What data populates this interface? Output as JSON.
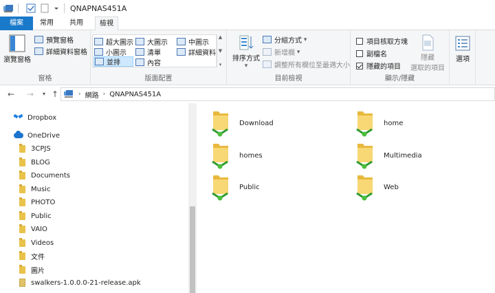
{
  "window": {
    "title": "QNAPNAS451A"
  },
  "tabs": {
    "file": "檔案",
    "home": "常用",
    "share": "共用",
    "view": "檢視"
  },
  "ribbon": {
    "panes": {
      "label": "窗格",
      "nav_pane": "瀏覽窗格",
      "preview": "預覽窗格",
      "details": "詳細資料窗格"
    },
    "layout": {
      "label": "版面配置",
      "extra_large": "超大圖示",
      "large": "大圖示",
      "medium": "中圖示",
      "small": "小圖示",
      "list": "清單",
      "details": "詳細資料",
      "tiles": "並排",
      "content": "內容"
    },
    "current_view": {
      "label": "目前檢視",
      "sort_by": "排序方式",
      "group_by": "分組方式",
      "add_column": "新增欄",
      "fit_columns": "調整所有欄位至最適大小"
    },
    "show_hide": {
      "label": "顯示/隱藏",
      "item_checkboxes": "項目核取方塊",
      "extensions": "副檔名",
      "hidden_items": "隱藏的項目",
      "hide_selected_l1": "隱藏",
      "hide_selected_l2": "選取的項目"
    },
    "options": {
      "label": "選項"
    }
  },
  "address": {
    "root": "網路",
    "leaf": "QNAPNAS451A"
  },
  "nav_pane": {
    "dropbox": "Dropbox",
    "onedrive": "OneDrive",
    "folders": [
      "3CPJS",
      "BLOG",
      "Documents",
      "Music",
      "PHOTO",
      "Public",
      "VAIO",
      "Videos",
      "文件",
      "圖片"
    ],
    "file": "swalkers-1.0.0.0-21-release.apk"
  },
  "shares": [
    "Download",
    "home",
    "homes",
    "Multimedia",
    "Public",
    "Web"
  ],
  "colors": {
    "accent": "#1979ca",
    "selected": "#cde8ff"
  }
}
